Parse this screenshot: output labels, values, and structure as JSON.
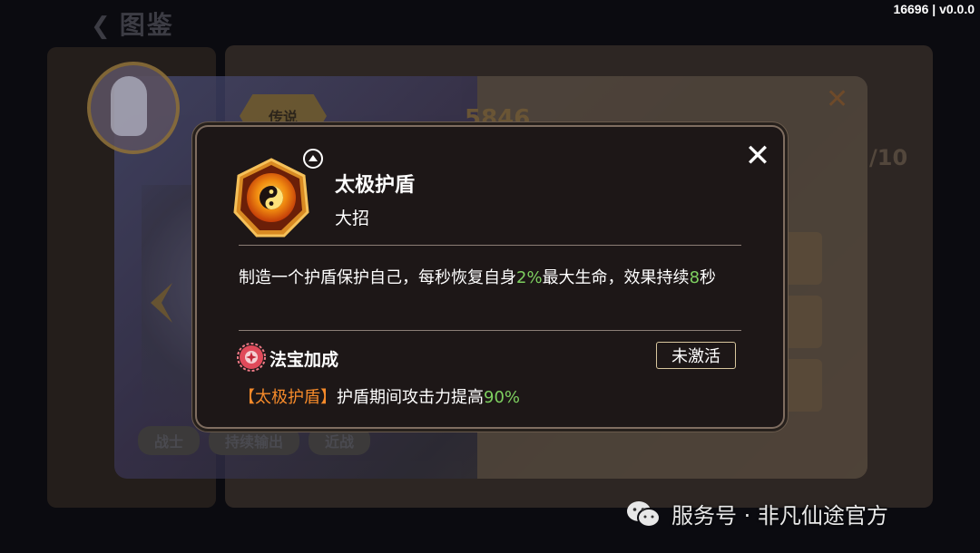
{
  "header": {
    "back_title": "图鉴",
    "version": "16696 | v0.0.0"
  },
  "background": {
    "rarity_badge": "传说",
    "power_value": "5846",
    "level_text": "/10",
    "tags": [
      "战士",
      "持续输出",
      "近战"
    ]
  },
  "dialog": {
    "skill_name": "太极护盾",
    "skill_type": "大招",
    "description": {
      "part1": "制造一个护盾保护自己，每秒恢复自身",
      "value1": "2%",
      "part2": "最大生命，效果持续",
      "value2": "8",
      "part3": "秒"
    },
    "treasure": {
      "title": "法宝加成",
      "status": "未激活",
      "bonus_tag": "【太极护盾】",
      "bonus_text": "护盾期间攻击力提高",
      "bonus_value": "90%"
    },
    "close_icon": "close-icon"
  },
  "watermark": {
    "text": "服务号 · 非凡仙途官方",
    "icon": "wechat-icon"
  },
  "colors": {
    "highlight_green": "#7ed060",
    "tag_orange": "#f58a2a",
    "dialog_bg": "#1d1717",
    "dialog_border": "#7f6d60"
  }
}
